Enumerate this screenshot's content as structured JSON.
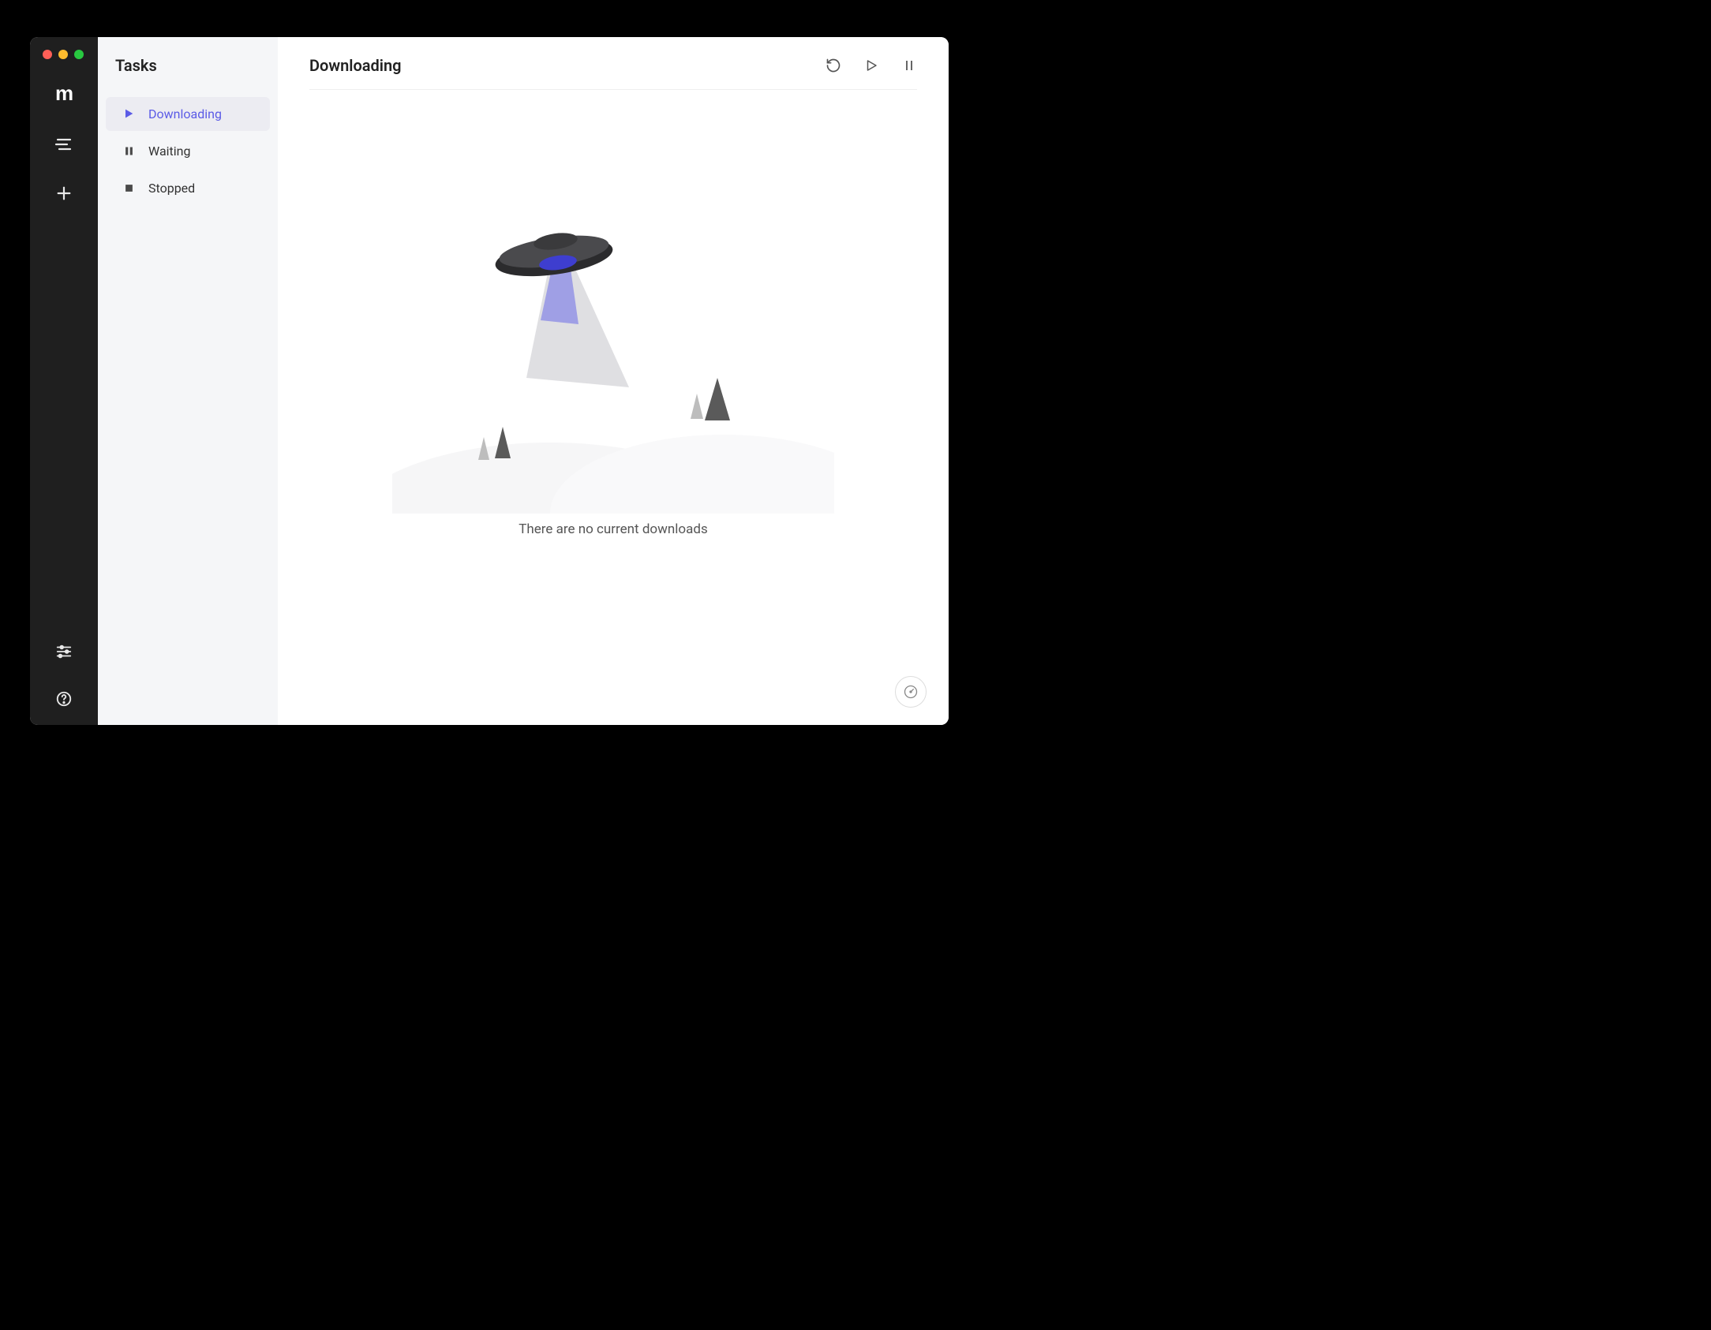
{
  "sidebar": {
    "title": "Tasks",
    "items": [
      {
        "label": "Downloading",
        "icon": "play",
        "active": true
      },
      {
        "label": "Waiting",
        "icon": "pause",
        "active": false
      },
      {
        "label": "Stopped",
        "icon": "stop",
        "active": false
      }
    ]
  },
  "main": {
    "title": "Downloading",
    "empty_message": "There are no current downloads",
    "actions": {
      "refresh": "refresh",
      "resume": "resume",
      "pause": "pause"
    }
  },
  "rail": {
    "logo": "m",
    "items": {
      "tasks": "tasks",
      "add": "add",
      "settings": "settings",
      "help": "help"
    }
  },
  "colors": {
    "accent": "#5b5be6"
  }
}
